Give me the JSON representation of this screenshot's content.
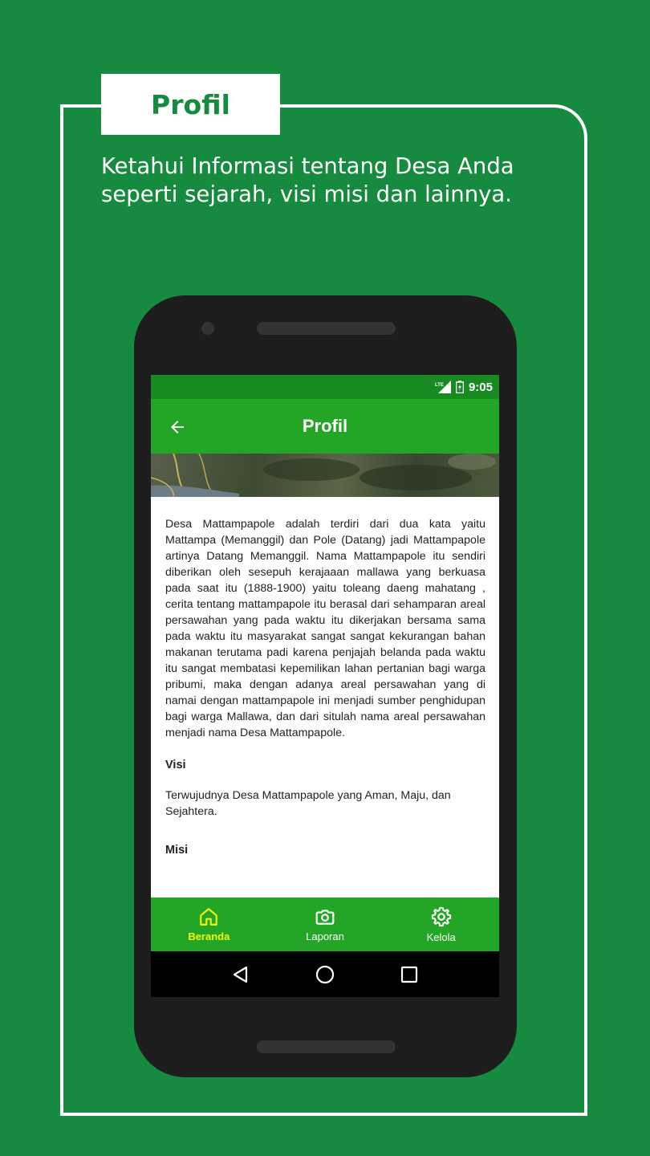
{
  "promo": {
    "title": "Profil",
    "tagline_line1": "Ketahui Informasi tentang Desa Anda",
    "tagline_line2": "seperti sejarah, visi misi dan lainnya."
  },
  "statusbar": {
    "network": "LTE",
    "time": "9:05"
  },
  "appbar": {
    "title": "Profil"
  },
  "content": {
    "history": "Desa Mattampapole adalah terdiri dari dua kata yaitu Mattampa (Memanggil) dan Pole (Datang) jadi Mattampapole artinya Datang Memanggil. Nama Mattampapole itu sendiri diberikan oleh sesepuh kerajaaan mallawa yang berkuasa pada saat itu (1888-1900) yaitu toleang daeng mahatang , cerita tentang mattampapole itu berasal dari sehamparan areal persawahan yang pada waktu itu dikerjakan bersama sama pada waktu itu masyarakat sangat sangat kekurangan bahan makanan terutama padi karena penjajah belanda pada waktu itu sangat membatasi kepemilikan lahan pertanian bagi warga pribumi, maka dengan adanya areal persawahan yang di namai dengan mattampapole ini menjadi sumber penghidupan bagi warga Mallawa, dan dari situlah nama areal persawahan menjadi nama Desa Mattampapole.",
    "visi_heading": "Visi",
    "visi_text": "Terwujudnya Desa Mattampapole yang Aman, Maju, dan Sejahtera.",
    "misi_heading": "Misi"
  },
  "bottomnav": {
    "items": [
      {
        "label": "Beranda",
        "icon": "home-icon",
        "active": true
      },
      {
        "label": "Laporan",
        "icon": "camera-icon",
        "active": false
      },
      {
        "label": "Kelola",
        "icon": "gear-icon",
        "active": false
      }
    ]
  },
  "colors": {
    "background": "#168a3e",
    "appbar": "#23a626",
    "statusbar": "#178a22",
    "active_nav": "#f4f40a"
  }
}
